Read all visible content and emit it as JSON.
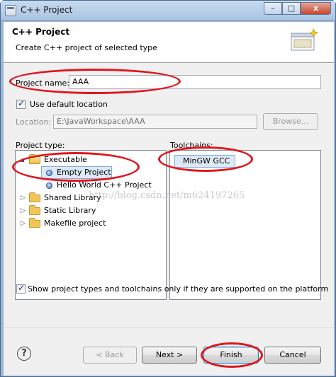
{
  "window": {
    "title": "C++ Project",
    "controls": {
      "minimize": "–",
      "maximize": "□",
      "close": "x"
    }
  },
  "header": {
    "title": "C++ Project",
    "description": "Create C++ project of selected type"
  },
  "project_name": {
    "label": "Project name:",
    "value": "AAA"
  },
  "default_location": {
    "label": "Use default location",
    "checked": true
  },
  "location": {
    "label": "Location:",
    "value": "E:\\JavaWorkspace\\AAA",
    "browse_label": "Browse..."
  },
  "project_type": {
    "label": "Project type:",
    "items": [
      {
        "label": "Executable",
        "level": 0,
        "expanded": true
      },
      {
        "label": "Empty Project",
        "level": 1,
        "selected": true
      },
      {
        "label": "Hello World C++ Project",
        "level": 1
      },
      {
        "label": "Shared Library",
        "level": 0,
        "expanded": false
      },
      {
        "label": "Static Library",
        "level": 0,
        "expanded": false
      },
      {
        "label": "Makefile project",
        "level": 0,
        "expanded": false
      }
    ]
  },
  "toolchains": {
    "label": "Toolchains:",
    "items": [
      "MinGW GCC"
    ]
  },
  "show_supported": {
    "label": "Show project types and toolchains only if they are supported on the platform",
    "checked": true
  },
  "watermark": "http://blog.csdn.net/m624197265",
  "buttons": {
    "help": "?",
    "back": "< Back",
    "next": "Next >",
    "finish": "Finish",
    "cancel": "Cancel"
  },
  "annotation_color": "#e0161e"
}
